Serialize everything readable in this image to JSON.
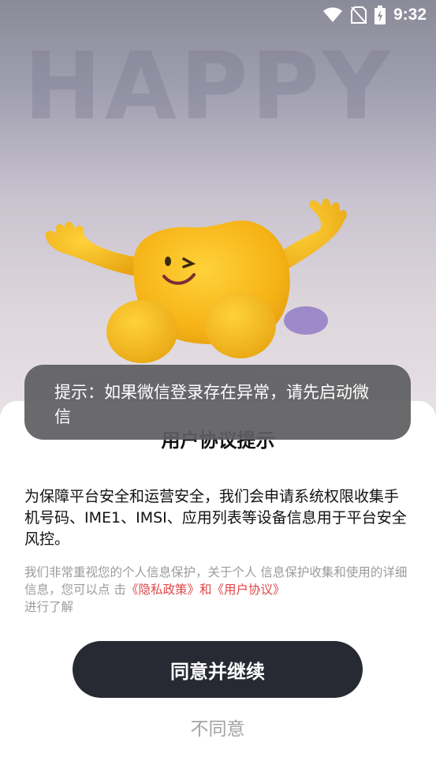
{
  "status_bar": {
    "time": "9:32",
    "icons": [
      "wifi-icon",
      "sim-none-icon",
      "battery-charging-icon"
    ]
  },
  "background": {
    "word": "HAPPY"
  },
  "dialog": {
    "title": "用户协议提示",
    "main_text": "为保障平台安全和运营安全，我们会申请系统权限收集手机号码、IME1、IMSI、应用列表等设备信息用于平台安全风控。",
    "sub_text_prefix": "我们非常重视您的个人信息保护，关于个人 信息保护收集和使用的详细信息，您可以点 击",
    "privacy_link": "《隐私政策》",
    "and_text": "和",
    "user_agreement_link": "《用户协议》",
    "sub_text_suffix": "进行了解",
    "agree_label": "同意并继续",
    "disagree_label": "不同意",
    "accent_color": "#e2464a",
    "button_color": "#272a33"
  },
  "toast": {
    "text": "提示：如果微信登录存在异常，请先启动微信"
  }
}
